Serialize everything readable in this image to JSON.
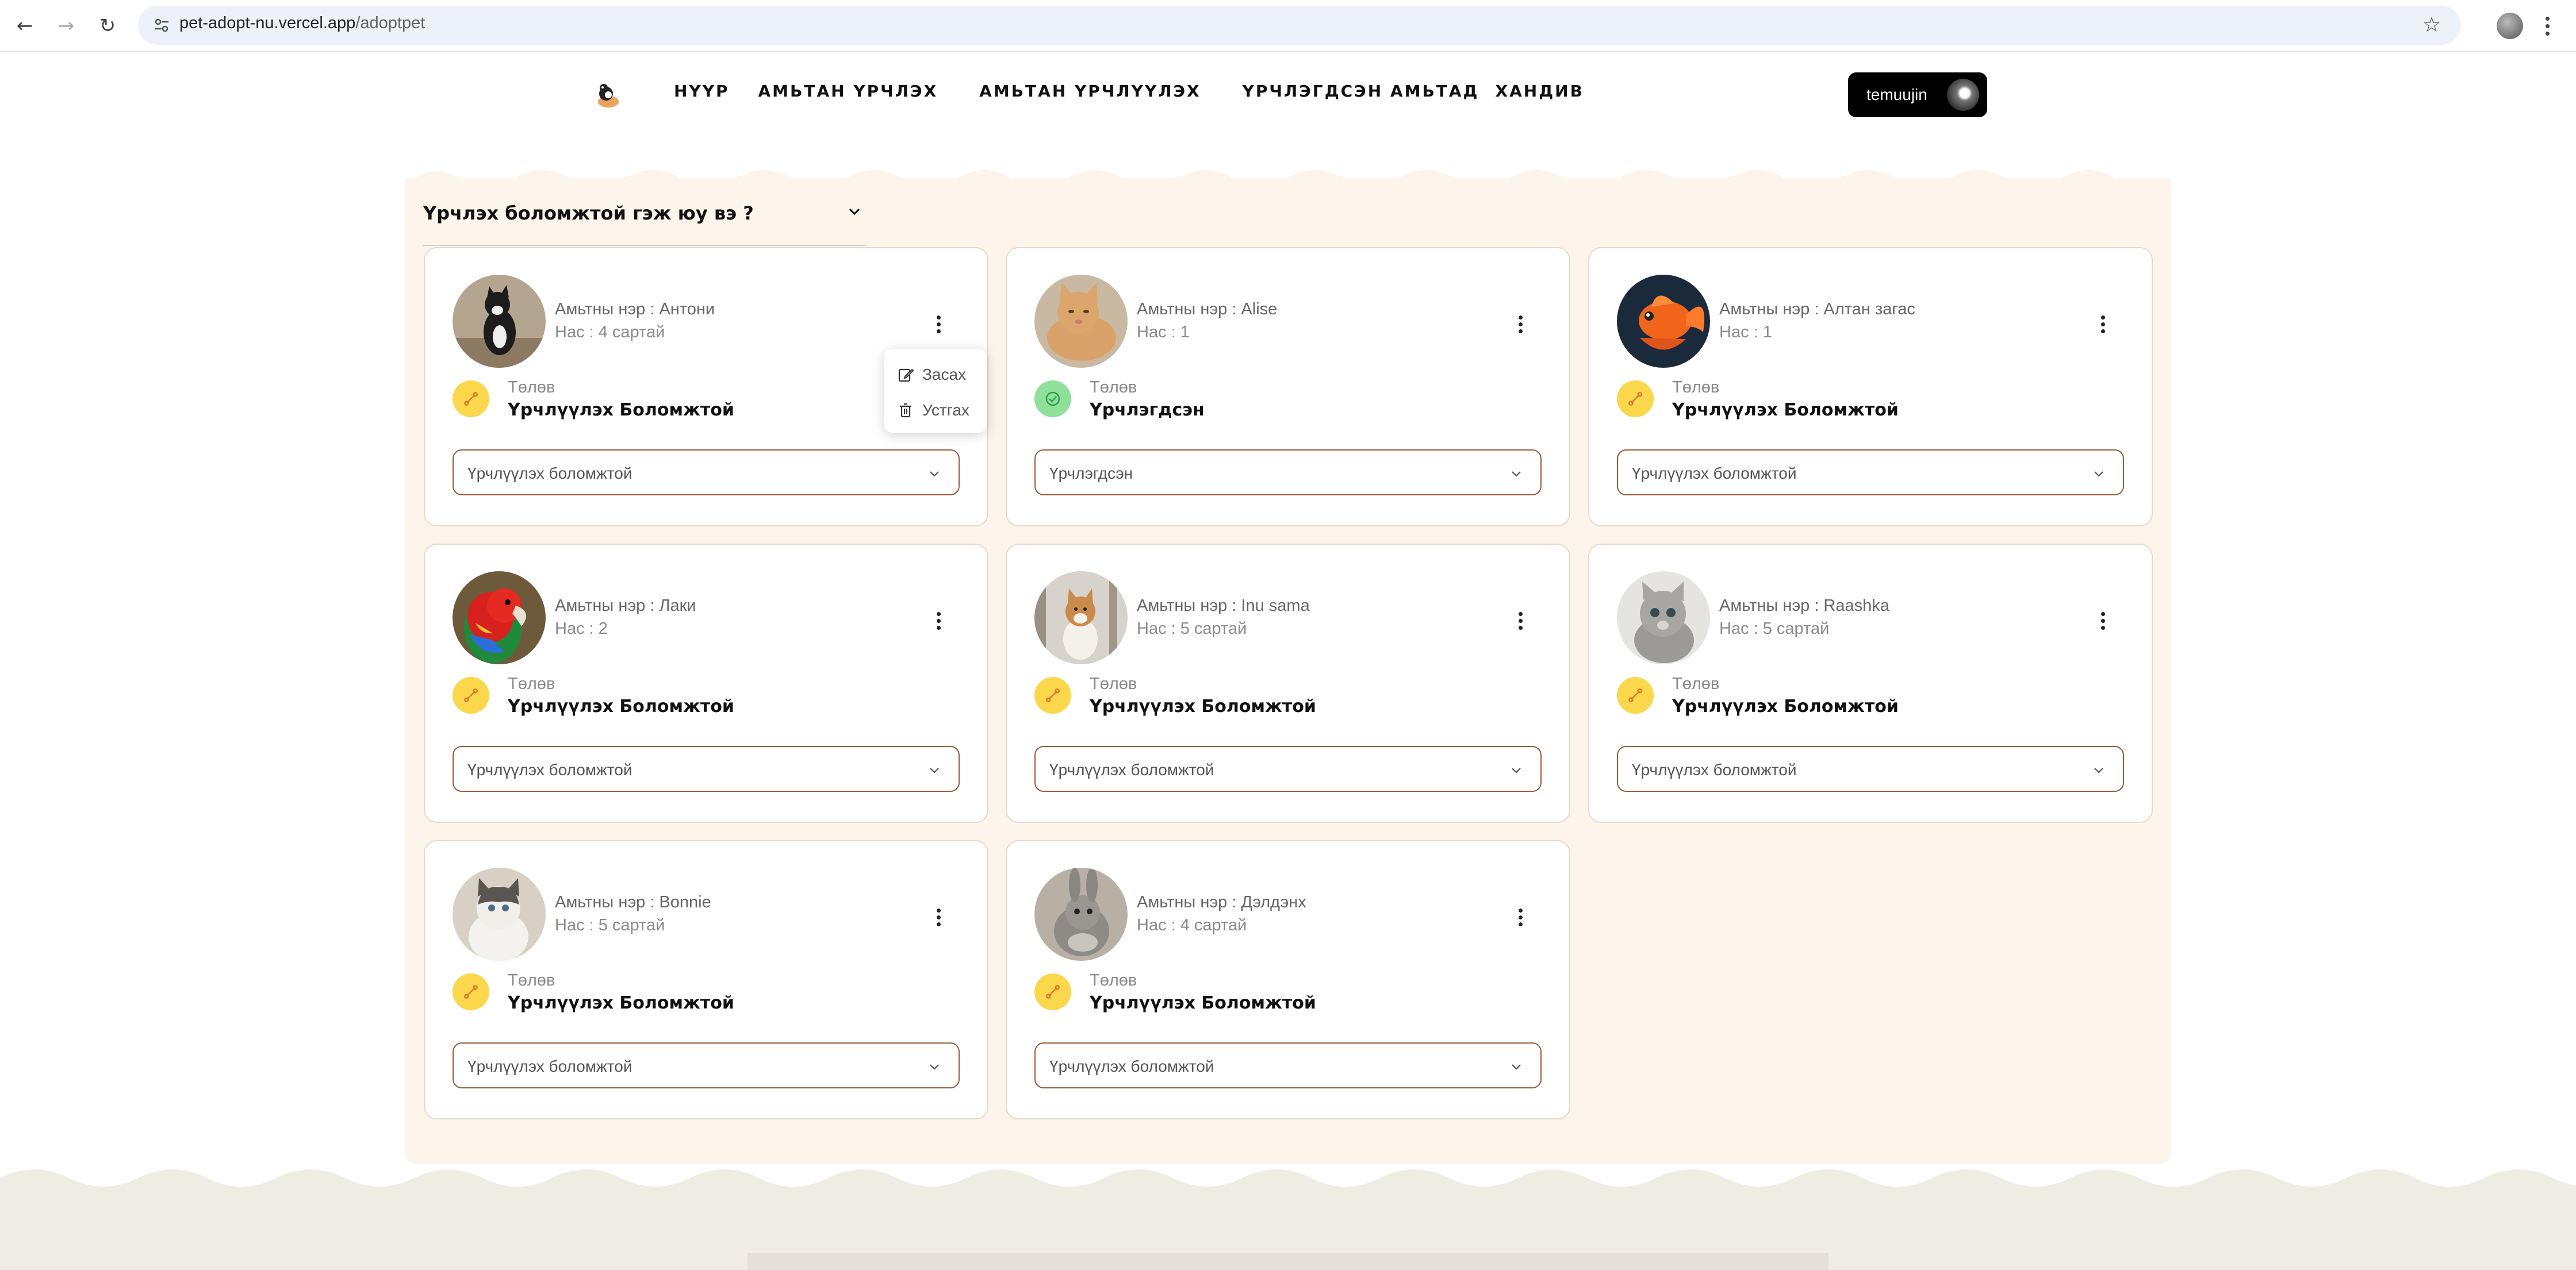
{
  "browser": {
    "url_host": "pet-adopt-nu.vercel.app",
    "url_path": "/adoptpet"
  },
  "nav": {
    "items": [
      {
        "label": "НҮҮР"
      },
      {
        "label": "АМЬТАН ҮРЧЛЭХ"
      },
      {
        "label": "АМЬТАН ҮРЧЛҮҮЛЭХ"
      },
      {
        "label": "ҮРЧЛЭГДСЭН АМЬТАД"
      },
      {
        "label": "ХАНДИВ"
      }
    ]
  },
  "user": {
    "name": "temuujin"
  },
  "faq": {
    "question": "Үрчлэх боломжтой гэж юу вэ ?"
  },
  "popup": {
    "edit_label": "Засах",
    "delete_label": "Устгах"
  },
  "pets": [
    {
      "name": "Амьтны нэр : Антони",
      "age": "Нас : 4 сартай",
      "status_label": "Төлөв",
      "status": "Үрчлүүлэх Боломжтой",
      "select_value": "Үрчлүүлэх боломжтой",
      "status_color": "yellow",
      "photo": "black-cat"
    },
    {
      "name": "Амьтны нэр : Alise",
      "age": "Нас : 1",
      "status_label": "Төлөв",
      "status": "Үрчлэгдсэн",
      "select_value": "Үрчлэгдсэн",
      "status_color": "green",
      "photo": "orange-cat"
    },
    {
      "name": "Амьтны нэр : Алтан загас",
      "age": "Нас : 1",
      "status_label": "Төлөв",
      "status": "Үрчлүүлэх Боломжтой",
      "select_value": "Үрчлүүлэх боломжтой",
      "status_color": "yellow",
      "photo": "goldfish"
    },
    {
      "name": "Амьтны нэр : Лаки",
      "age": "Нас : 2",
      "status_label": "Төлөв",
      "status": "Үрчлүүлэх Боломжтой",
      "select_value": "Үрчлүүлэх боломжтой",
      "status_color": "yellow",
      "photo": "parrot"
    },
    {
      "name": "Амьтны нэр : Inu sama",
      "age": "Нас : 5 сартай",
      "status_label": "Төлөв",
      "status": "Үрчлүүлэх Боломжтой",
      "select_value": "Үрчлүүлэх боломжтой",
      "status_color": "yellow",
      "photo": "shiba-dog"
    },
    {
      "name": "Амьтны нэр : Raashka",
      "age": "Нас : 5 сартай",
      "status_label": "Төлөв",
      "status": "Үрчлүүлэх Боломжтой",
      "select_value": "Үрчлүүлэх боломжтой",
      "status_color": "yellow",
      "photo": "grey-kitten"
    },
    {
      "name": "Амьтны нэр : Bonnie",
      "age": "Нас : 5 сартай",
      "status_label": "Төлөв",
      "status": "Үрчлүүлэх Боломжтой",
      "select_value": "Үрчлүүлэх боломжтой",
      "status_color": "yellow",
      "photo": "ragdoll-cat"
    },
    {
      "name": "Амьтны нэр : Дэлдэнх",
      "age": "Нас : 4 сартай",
      "status_label": "Төлөв",
      "status": "Үрчлүүлэх Боломжтой",
      "select_value": "Үрчлүүлэх боломжтой",
      "status_color": "yellow",
      "photo": "rabbit"
    }
  ],
  "colors": {
    "panel_bg": "#fdf5ec",
    "card_border": "#e8d8c7",
    "select_border": "#9a5b3a",
    "status_yellow": "#fbd74b",
    "status_green": "#8ee09b",
    "footer_bg": "#efece4"
  }
}
